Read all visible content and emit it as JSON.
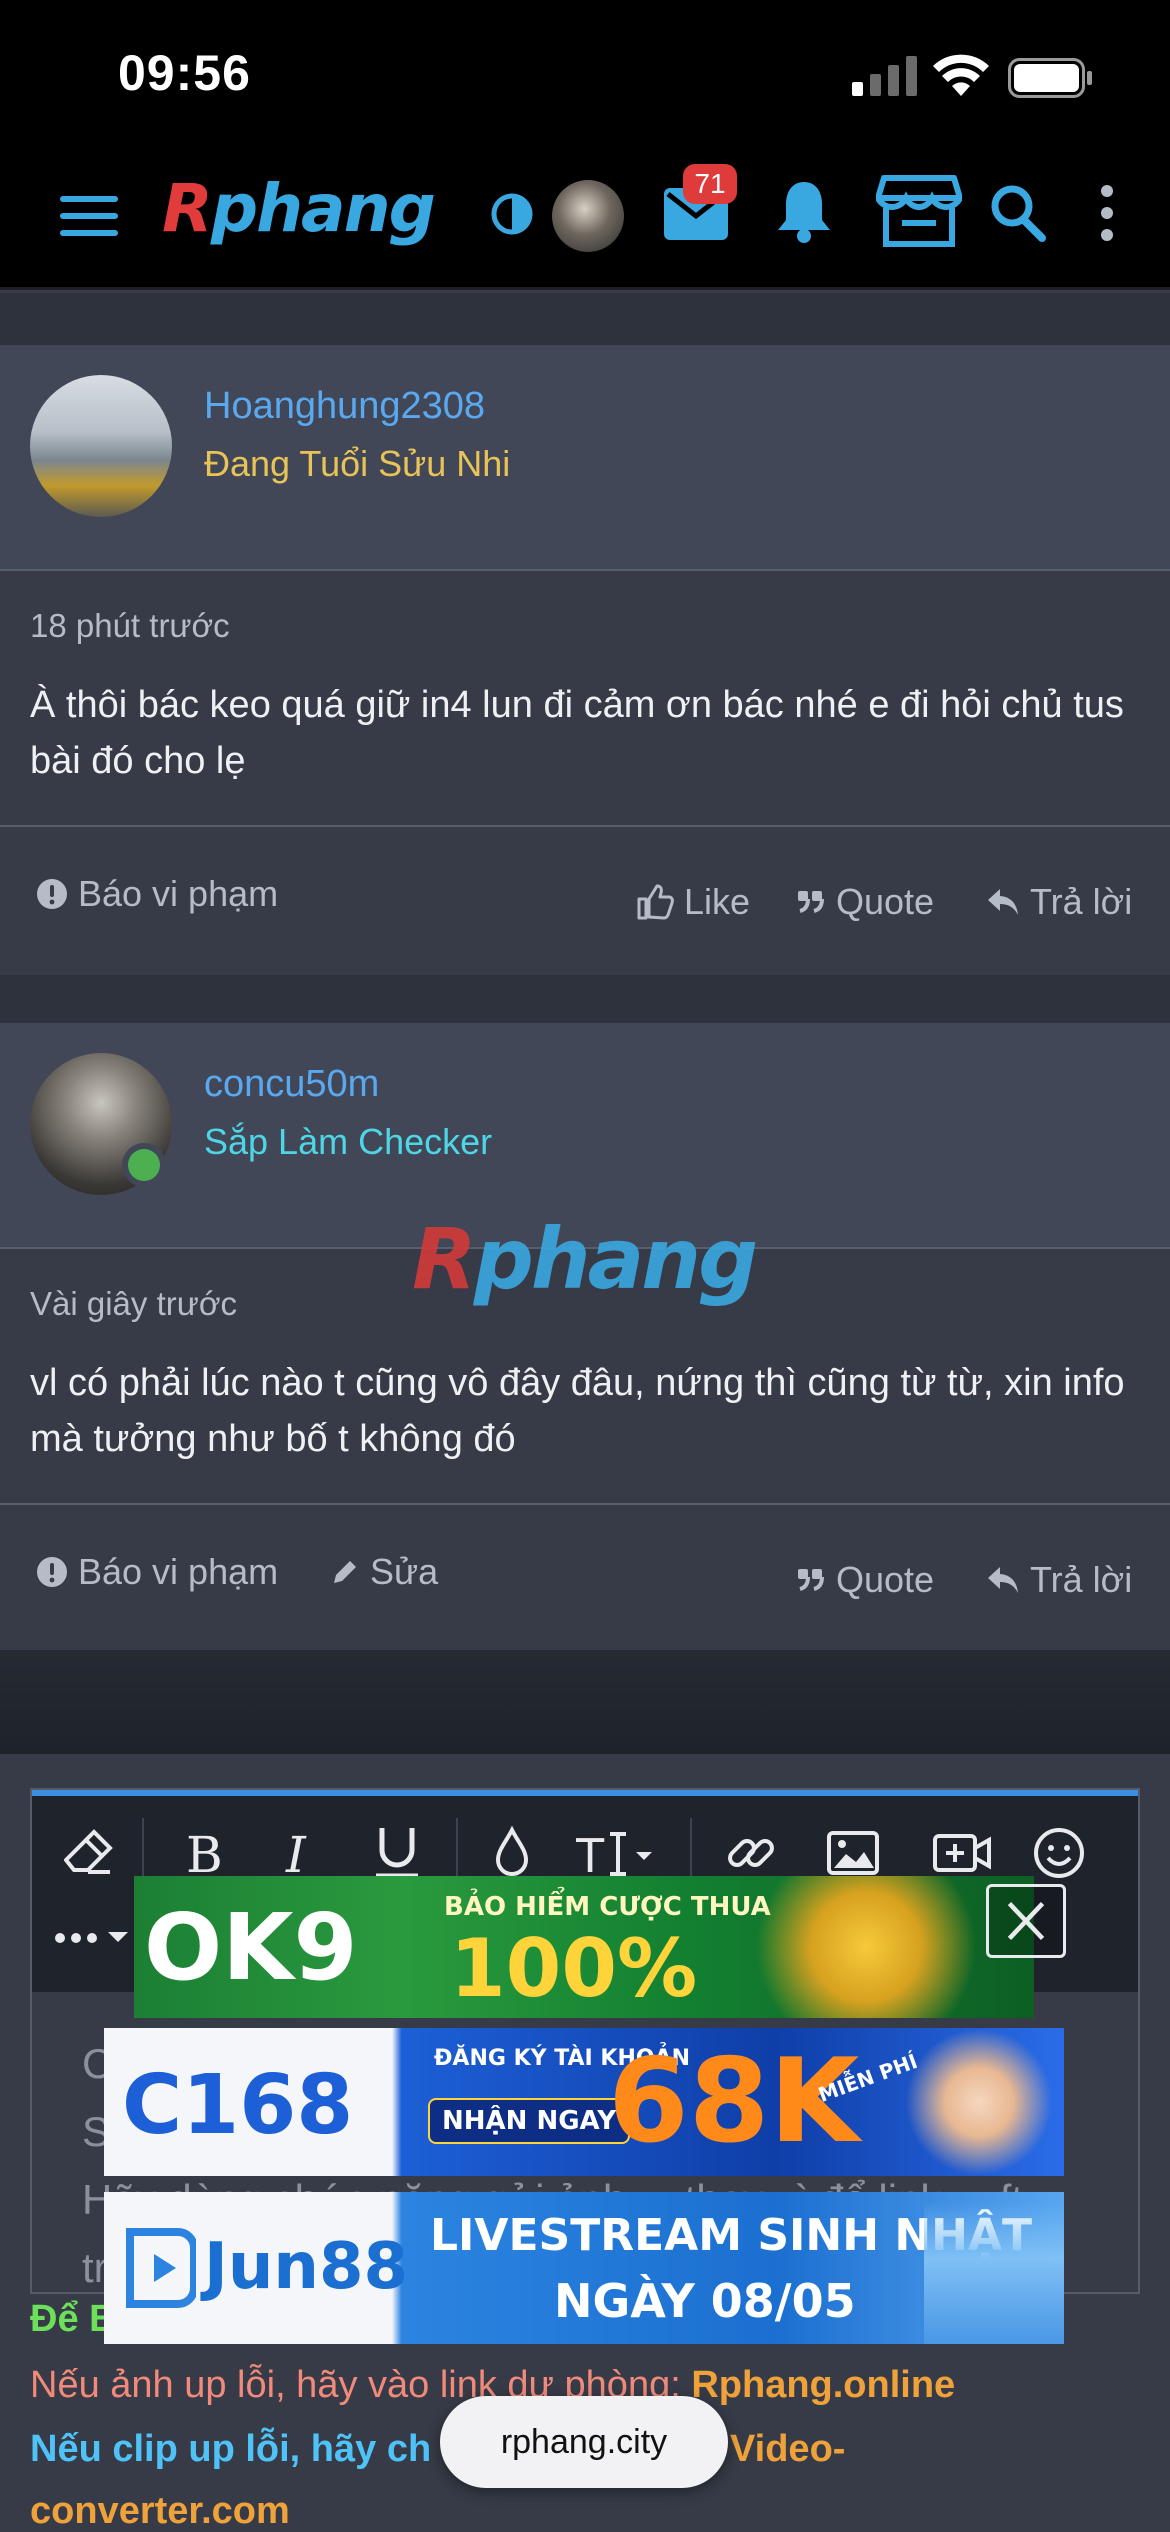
{
  "status_bar": {
    "time": "09:56"
  },
  "nav": {
    "logo_left": "R",
    "logo_right": "phang",
    "messages_badge": "71"
  },
  "posts": [
    {
      "username": "Hoanghung2308",
      "user_title": "Đang Tuổi Sửu Nhi",
      "user_title_color": "#e8c458",
      "time": "18 phút trước",
      "body": "À thôi bác keo quá giữ in4 lun đi cảm ơn bác nhé e đi hỏi chủ tus bài đó cho lẹ",
      "actions": {
        "report": "Báo vi phạm",
        "like": "Like",
        "quote": "Quote",
        "reply": "Trả lời"
      }
    },
    {
      "username": "concu50m",
      "user_title": "Sắp Làm Checker",
      "user_title_color": "#4fd6e6",
      "time": "Vài giây trước",
      "body": "vl có phải lúc nào t cũng vô đây đâu, nứng thì cũng từ từ, xin info mà tưởng như bố t không đó",
      "actions": {
        "report": "Báo vi phạm",
        "edit": "Sửa",
        "quote": "Quote",
        "reply": "Trả lời"
      }
    }
  ],
  "watermark": {
    "left": "R",
    "right": "phang"
  },
  "editor": {
    "placeholder_lines": [
      "C",
      "S",
      "Hãy dùng chức năng gửi ảnh ... thay vì để link ... ft",
      "tr"
    ]
  },
  "info": {
    "line1_prefix": "Để B",
    "line2_prefix": "Nếu ảnh up lỗi, hãy vào link dự phòng: ",
    "line2_link": "Rphang.online",
    "line3_prefix": "Nếu clip up lỗi, hãy ch",
    "line3_link": "Video-",
    "line4_link": "converter.com"
  },
  "ads": {
    "ok9": {
      "brand": "OK9",
      "headline": "BẢO HIỂM CƯỢC THUA",
      "big": "100%"
    },
    "c168": {
      "brand": "C168",
      "small": "ĐĂNG KÝ TÀI KHOẢN",
      "cta": "NHẬN NGAY",
      "big": "68K",
      "tag": "MIỄN PHÍ"
    },
    "jun88": {
      "brand": "Jun88",
      "headline": "LIVESTREAM SINH NHẬT",
      "date": "NGÀY 08/05"
    }
  },
  "url_bar": {
    "domain": "rphang.city"
  },
  "colors": {
    "accent": "#5aa9f0",
    "link_orange": "#f0a23a",
    "link_cyan": "#4fc3f7",
    "green": "#6de05a",
    "salmon": "#f08a7a"
  }
}
